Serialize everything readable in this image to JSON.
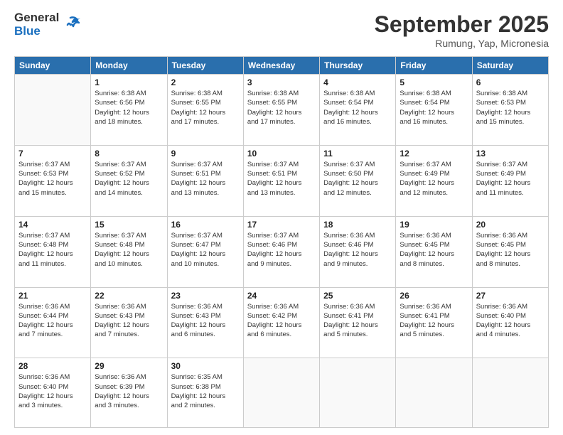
{
  "header": {
    "logo_general": "General",
    "logo_blue": "Blue",
    "month": "September 2025",
    "location": "Rumung, Yap, Micronesia"
  },
  "days_of_week": [
    "Sunday",
    "Monday",
    "Tuesday",
    "Wednesday",
    "Thursday",
    "Friday",
    "Saturday"
  ],
  "weeks": [
    [
      {
        "day": "",
        "info": ""
      },
      {
        "day": "1",
        "info": "Sunrise: 6:38 AM\nSunset: 6:56 PM\nDaylight: 12 hours\nand 18 minutes."
      },
      {
        "day": "2",
        "info": "Sunrise: 6:38 AM\nSunset: 6:55 PM\nDaylight: 12 hours\nand 17 minutes."
      },
      {
        "day": "3",
        "info": "Sunrise: 6:38 AM\nSunset: 6:55 PM\nDaylight: 12 hours\nand 17 minutes."
      },
      {
        "day": "4",
        "info": "Sunrise: 6:38 AM\nSunset: 6:54 PM\nDaylight: 12 hours\nand 16 minutes."
      },
      {
        "day": "5",
        "info": "Sunrise: 6:38 AM\nSunset: 6:54 PM\nDaylight: 12 hours\nand 16 minutes."
      },
      {
        "day": "6",
        "info": "Sunrise: 6:38 AM\nSunset: 6:53 PM\nDaylight: 12 hours\nand 15 minutes."
      }
    ],
    [
      {
        "day": "7",
        "info": "Sunrise: 6:37 AM\nSunset: 6:53 PM\nDaylight: 12 hours\nand 15 minutes."
      },
      {
        "day": "8",
        "info": "Sunrise: 6:37 AM\nSunset: 6:52 PM\nDaylight: 12 hours\nand 14 minutes."
      },
      {
        "day": "9",
        "info": "Sunrise: 6:37 AM\nSunset: 6:51 PM\nDaylight: 12 hours\nand 13 minutes."
      },
      {
        "day": "10",
        "info": "Sunrise: 6:37 AM\nSunset: 6:51 PM\nDaylight: 12 hours\nand 13 minutes."
      },
      {
        "day": "11",
        "info": "Sunrise: 6:37 AM\nSunset: 6:50 PM\nDaylight: 12 hours\nand 12 minutes."
      },
      {
        "day": "12",
        "info": "Sunrise: 6:37 AM\nSunset: 6:49 PM\nDaylight: 12 hours\nand 12 minutes."
      },
      {
        "day": "13",
        "info": "Sunrise: 6:37 AM\nSunset: 6:49 PM\nDaylight: 12 hours\nand 11 minutes."
      }
    ],
    [
      {
        "day": "14",
        "info": "Sunrise: 6:37 AM\nSunset: 6:48 PM\nDaylight: 12 hours\nand 11 minutes."
      },
      {
        "day": "15",
        "info": "Sunrise: 6:37 AM\nSunset: 6:48 PM\nDaylight: 12 hours\nand 10 minutes."
      },
      {
        "day": "16",
        "info": "Sunrise: 6:37 AM\nSunset: 6:47 PM\nDaylight: 12 hours\nand 10 minutes."
      },
      {
        "day": "17",
        "info": "Sunrise: 6:37 AM\nSunset: 6:46 PM\nDaylight: 12 hours\nand 9 minutes."
      },
      {
        "day": "18",
        "info": "Sunrise: 6:36 AM\nSunset: 6:46 PM\nDaylight: 12 hours\nand 9 minutes."
      },
      {
        "day": "19",
        "info": "Sunrise: 6:36 AM\nSunset: 6:45 PM\nDaylight: 12 hours\nand 8 minutes."
      },
      {
        "day": "20",
        "info": "Sunrise: 6:36 AM\nSunset: 6:45 PM\nDaylight: 12 hours\nand 8 minutes."
      }
    ],
    [
      {
        "day": "21",
        "info": "Sunrise: 6:36 AM\nSunset: 6:44 PM\nDaylight: 12 hours\nand 7 minutes."
      },
      {
        "day": "22",
        "info": "Sunrise: 6:36 AM\nSunset: 6:43 PM\nDaylight: 12 hours\nand 7 minutes."
      },
      {
        "day": "23",
        "info": "Sunrise: 6:36 AM\nSunset: 6:43 PM\nDaylight: 12 hours\nand 6 minutes."
      },
      {
        "day": "24",
        "info": "Sunrise: 6:36 AM\nSunset: 6:42 PM\nDaylight: 12 hours\nand 6 minutes."
      },
      {
        "day": "25",
        "info": "Sunrise: 6:36 AM\nSunset: 6:41 PM\nDaylight: 12 hours\nand 5 minutes."
      },
      {
        "day": "26",
        "info": "Sunrise: 6:36 AM\nSunset: 6:41 PM\nDaylight: 12 hours\nand 5 minutes."
      },
      {
        "day": "27",
        "info": "Sunrise: 6:36 AM\nSunset: 6:40 PM\nDaylight: 12 hours\nand 4 minutes."
      }
    ],
    [
      {
        "day": "28",
        "info": "Sunrise: 6:36 AM\nSunset: 6:40 PM\nDaylight: 12 hours\nand 3 minutes."
      },
      {
        "day": "29",
        "info": "Sunrise: 6:36 AM\nSunset: 6:39 PM\nDaylight: 12 hours\nand 3 minutes."
      },
      {
        "day": "30",
        "info": "Sunrise: 6:35 AM\nSunset: 6:38 PM\nDaylight: 12 hours\nand 2 minutes."
      },
      {
        "day": "",
        "info": ""
      },
      {
        "day": "",
        "info": ""
      },
      {
        "day": "",
        "info": ""
      },
      {
        "day": "",
        "info": ""
      }
    ]
  ]
}
